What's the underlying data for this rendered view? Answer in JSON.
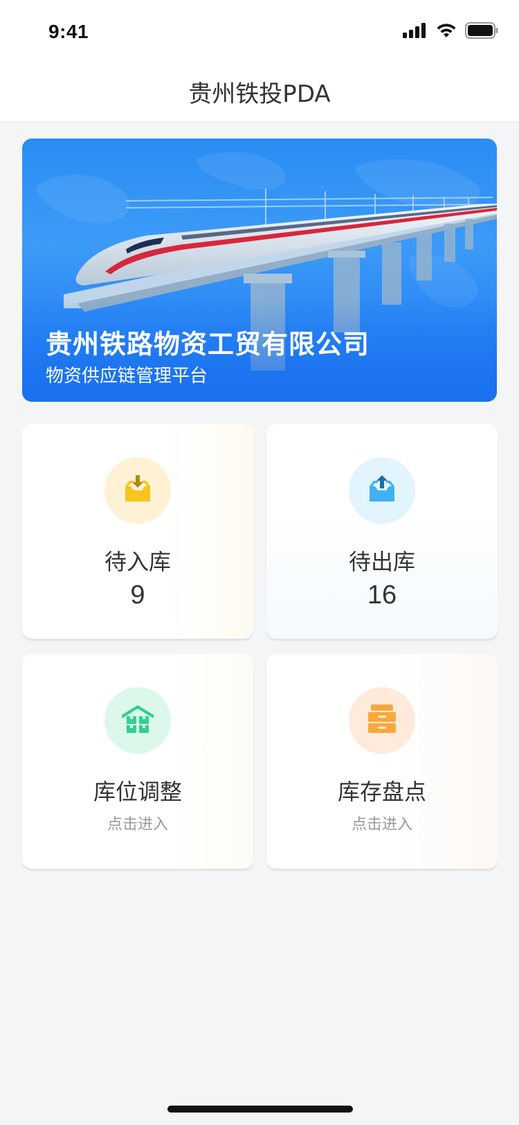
{
  "status_bar": {
    "time": "9:41",
    "icons": [
      "signal-icon",
      "wifi-icon",
      "battery-icon"
    ]
  },
  "header": {
    "title": "贵州铁投PDA"
  },
  "banner": {
    "title": "贵州铁路物资工贸有限公司",
    "subtitle": "物资供应链管理平台"
  },
  "cards": [
    {
      "label": "待入库",
      "value": "9",
      "icon": "inbox-download-icon",
      "icon_color": "#f7c51e",
      "icon_bg": "#fff1d3"
    },
    {
      "label": "待出库",
      "value": "16",
      "icon": "inbox-upload-icon",
      "icon_color": "#3fb2f5",
      "icon_bg": "#e2f4fe"
    },
    {
      "label": "库位调整",
      "hint": "点击进入",
      "icon": "warehouse-icon",
      "icon_color": "#2fd191",
      "icon_bg": "#dcf8ea"
    },
    {
      "label": "库存盘点",
      "hint": "点击进入",
      "icon": "drawer-cabinet-icon",
      "icon_color": "#f7a93a",
      "icon_bg": "#ffeadb"
    }
  ],
  "colors": {
    "page_bg": "#f4f5f7",
    "banner_blue": "#2a86f5"
  }
}
